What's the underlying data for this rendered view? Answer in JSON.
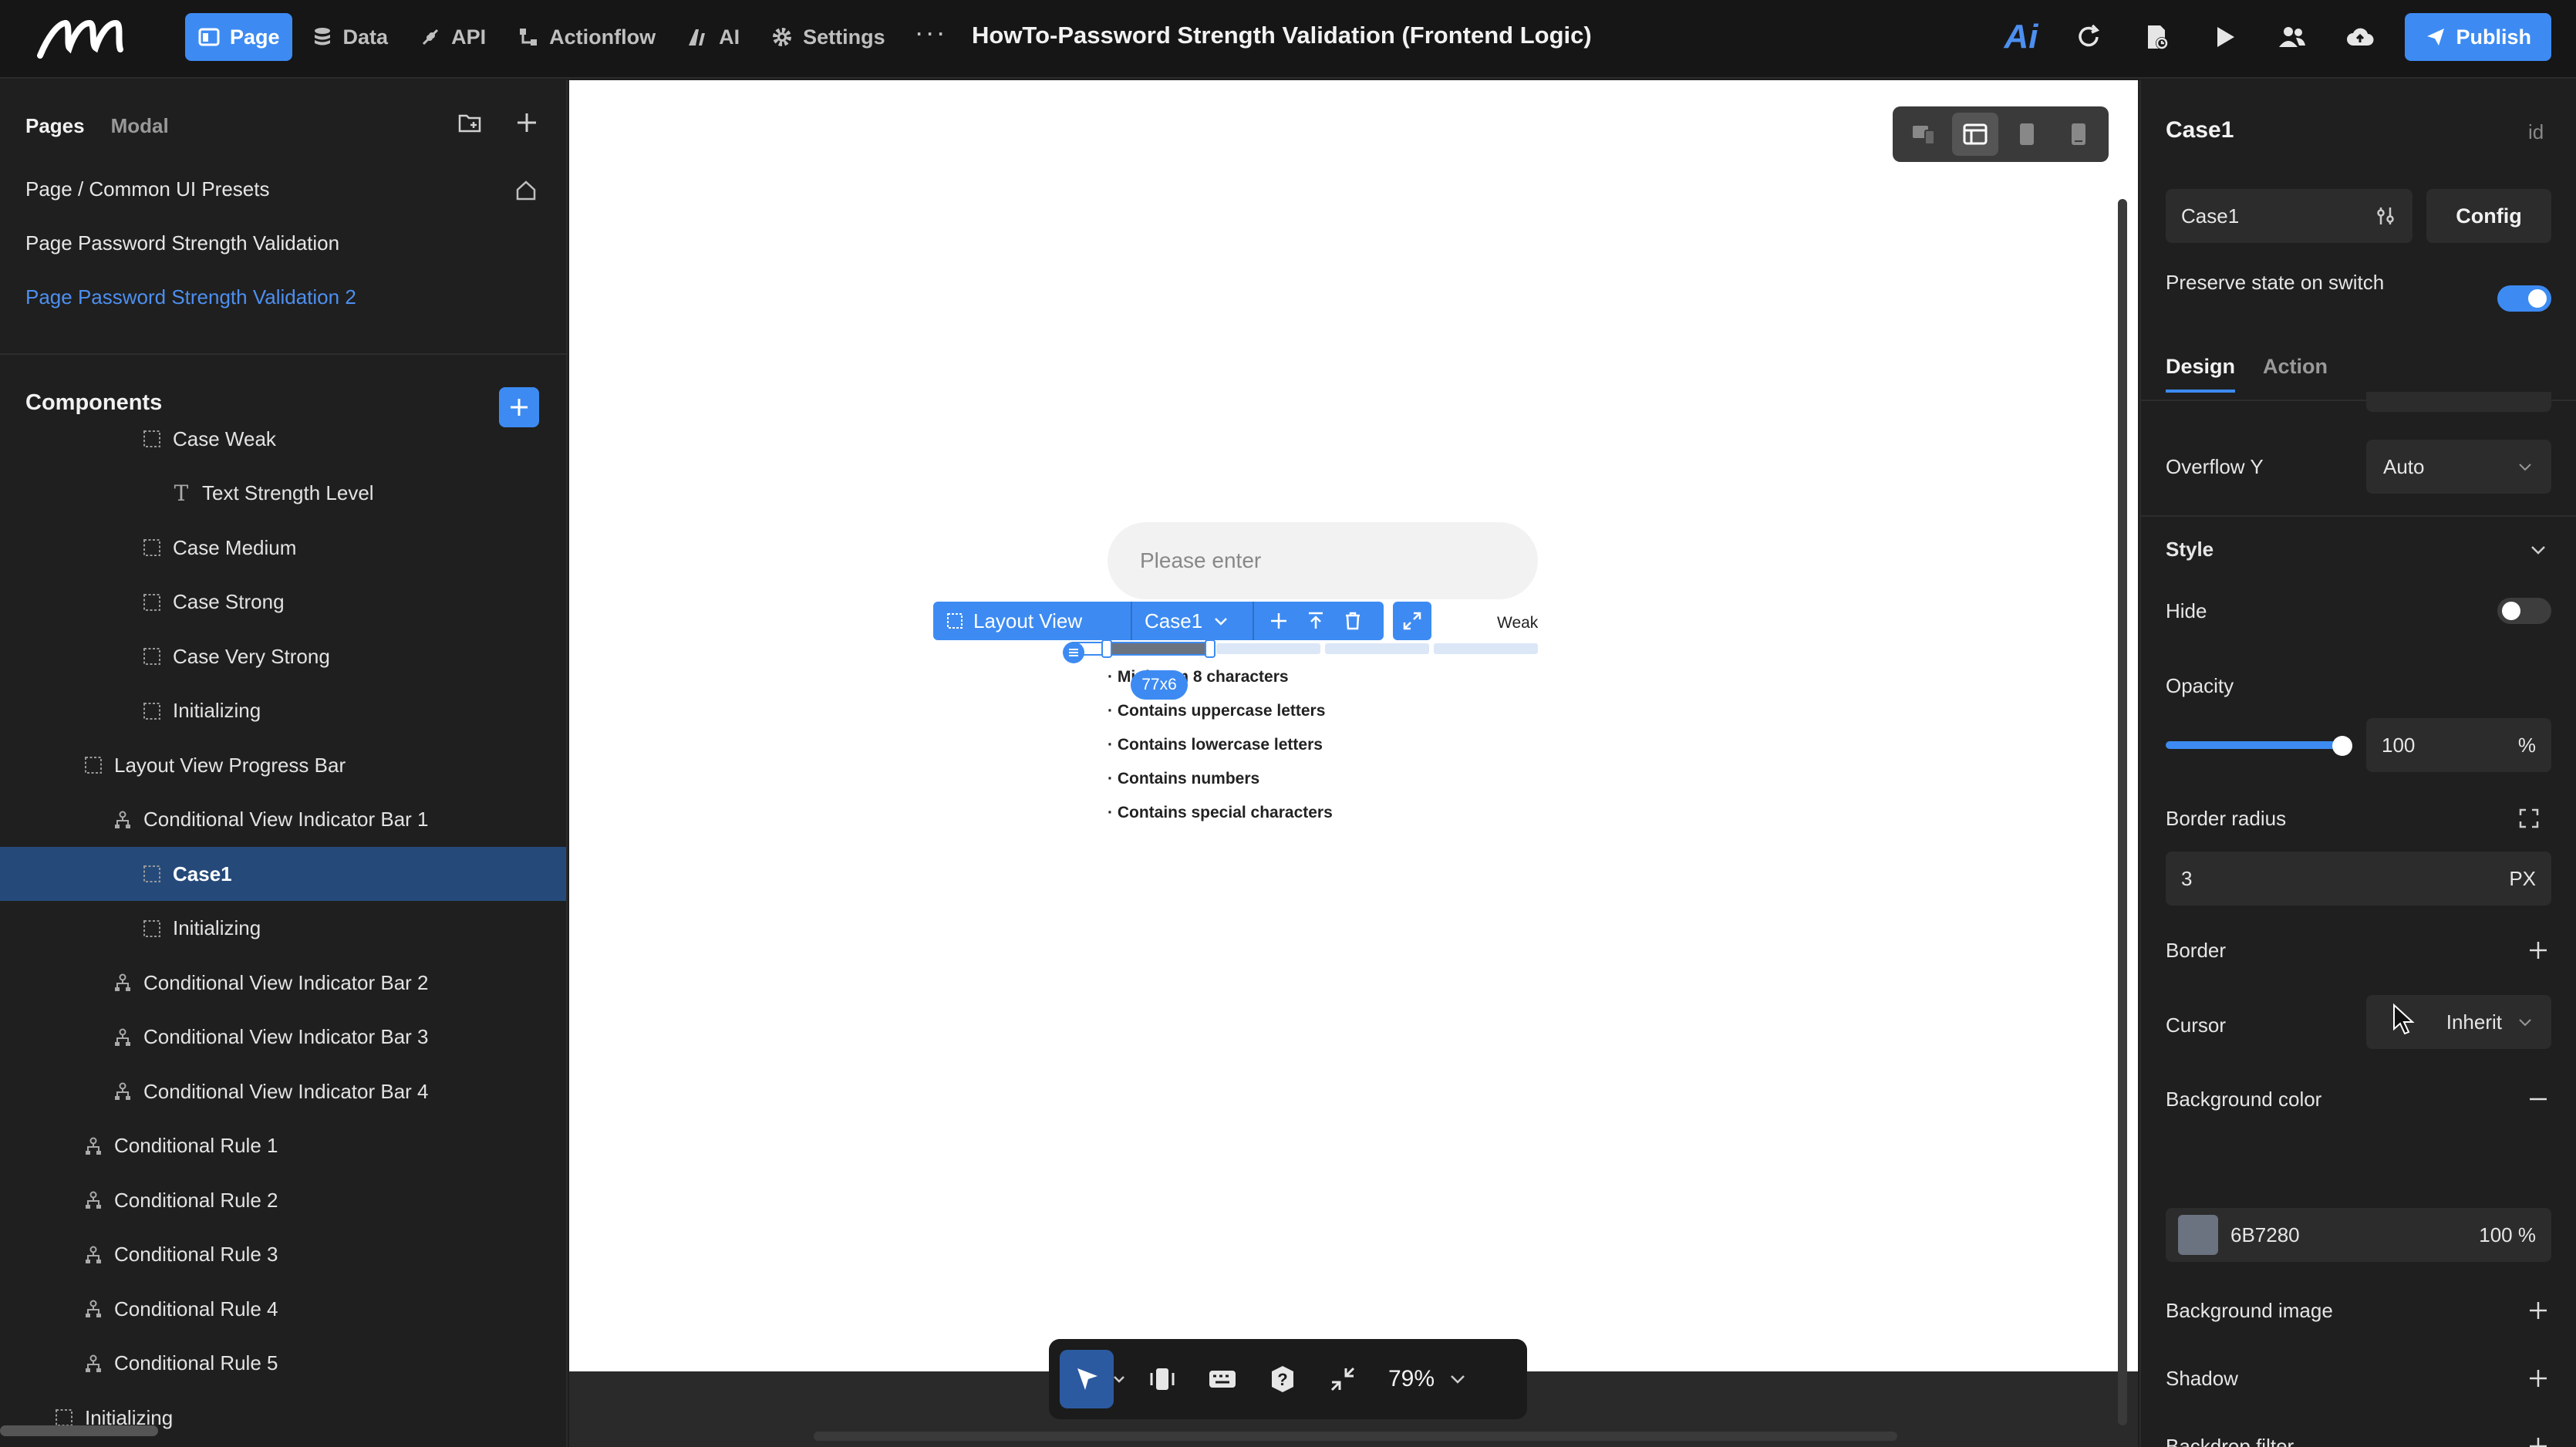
{
  "nav": {
    "items": [
      {
        "label": "Page",
        "icon": "page-icon",
        "active": true
      },
      {
        "label": "Data",
        "icon": "database-icon",
        "active": false
      },
      {
        "label": "API",
        "icon": "api-icon",
        "active": false
      },
      {
        "label": "Actionflow",
        "icon": "actionflow-icon",
        "active": false
      },
      {
        "label": "AI",
        "icon": "ai-icon",
        "active": false
      },
      {
        "label": "Settings",
        "icon": "gear-icon",
        "active": false
      }
    ],
    "more": "···",
    "doc_title": "HowTo-Password Strength Validation (Frontend Logic)",
    "ai_brand": "Ai",
    "publish_label": "Publish",
    "accent": "#3d8bf2"
  },
  "pages": {
    "tab_pages": "Pages",
    "tab_modal": "Modal",
    "items": [
      {
        "label": "Page / Common UI Presets",
        "selected": false
      },
      {
        "label": "Page Password Strength Validation",
        "selected": false
      },
      {
        "label": "Page Password Strength Validation 2",
        "selected": true
      }
    ]
  },
  "components": {
    "title": "Components",
    "tree": [
      {
        "label": "Case Weak",
        "icon": "dashed-box-icon",
        "depth": 5,
        "selected": false
      },
      {
        "label": "Text Strength Level",
        "icon": "text-icon",
        "depth": 6,
        "selected": false
      },
      {
        "label": "Case Medium",
        "icon": "dashed-box-icon",
        "depth": 5,
        "selected": false
      },
      {
        "label": "Case Strong",
        "icon": "dashed-box-icon",
        "depth": 5,
        "selected": false
      },
      {
        "label": "Case Very Strong",
        "icon": "dashed-box-icon",
        "depth": 5,
        "selected": false
      },
      {
        "label": "Initializing",
        "icon": "dashed-box-icon",
        "depth": 5,
        "selected": false
      },
      {
        "label": "Layout View Progress Bar",
        "icon": "dashed-box-icon",
        "depth": 3,
        "selected": false
      },
      {
        "label": "Conditional View Indicator Bar 1",
        "icon": "branch-icon",
        "depth": 4,
        "selected": false
      },
      {
        "label": "Case1",
        "icon": "dashed-box-icon",
        "depth": 5,
        "selected": true
      },
      {
        "label": "Initializing",
        "icon": "dashed-box-icon",
        "depth": 5,
        "selected": false
      },
      {
        "label": "Conditional View Indicator Bar 2",
        "icon": "branch-icon",
        "depth": 4,
        "selected": false
      },
      {
        "label": "Conditional View Indicator Bar 3",
        "icon": "branch-icon",
        "depth": 4,
        "selected": false
      },
      {
        "label": "Conditional View Indicator Bar 4",
        "icon": "branch-icon",
        "depth": 4,
        "selected": false
      },
      {
        "label": "Conditional Rule 1",
        "icon": "branch-icon",
        "depth": 3,
        "selected": false
      },
      {
        "label": "Conditional Rule 2",
        "icon": "branch-icon",
        "depth": 3,
        "selected": false
      },
      {
        "label": "Conditional Rule 3",
        "icon": "branch-icon",
        "depth": 3,
        "selected": false
      },
      {
        "label": "Conditional Rule 4",
        "icon": "branch-icon",
        "depth": 3,
        "selected": false
      },
      {
        "label": "Conditional Rule 5",
        "icon": "branch-icon",
        "depth": 3,
        "selected": false
      },
      {
        "label": "Initializing",
        "icon": "dashed-box-icon",
        "depth": 2,
        "selected": false
      }
    ]
  },
  "canvas": {
    "password_placeholder": "Please enter",
    "strength_word": "Weak",
    "layout_toolbar": {
      "component": "Layout View",
      "case": "Case1"
    },
    "size_badge": "77x6",
    "rules": [
      "· Minimum 8 characters",
      "· Contains uppercase letters",
      "· Contains lowercase letters",
      "· Contains numbers",
      "· Contains special characters"
    ],
    "zoom": "79%"
  },
  "inspector": {
    "title": "Case1",
    "id_label": "id",
    "case_name": "Case1",
    "config_label": "Config",
    "preserve_label": "Preserve state on switch",
    "preserve_on": true,
    "tab_design": "Design",
    "tab_action": "Action",
    "overflow_y_label": "Overflow Y",
    "overflow_y_value": "Auto",
    "style_label": "Style",
    "hide_label": "Hide",
    "hide_on": false,
    "opacity_label": "Opacity",
    "opacity_value": "100",
    "opacity_unit": "%",
    "border_radius_label": "Border radius",
    "border_radius_value": "3",
    "border_radius_unit": "PX",
    "border_label": "Border",
    "cursor_label": "Cursor",
    "cursor_value": "Inherit",
    "bg_color_label": "Background color",
    "bg_color_hex": "6B7280",
    "bg_color_alpha": "100",
    "bg_color_alpha_unit": "%",
    "bg_color_swatch": "#6b7280",
    "bg_image_label": "Background image",
    "shadow_label": "Shadow",
    "backdrop_label": "Backdrop filter"
  }
}
